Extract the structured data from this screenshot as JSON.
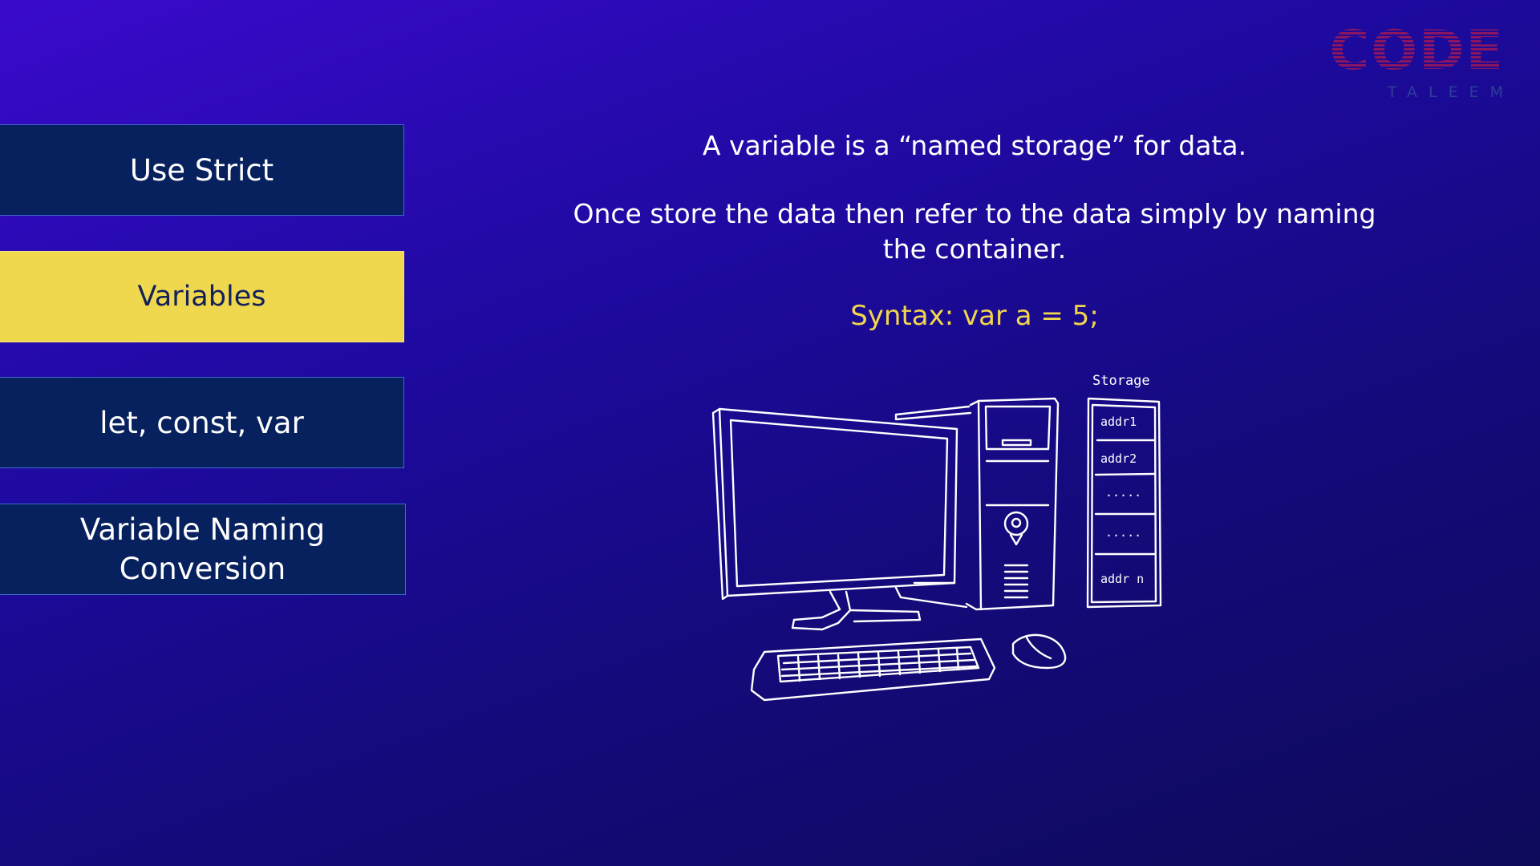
{
  "logo": {
    "main": "CODE",
    "sub": "TALEEM"
  },
  "nav": {
    "items": [
      {
        "label": "Use Strict",
        "active": false
      },
      {
        "label": "Variables",
        "active": true
      },
      {
        "label": "let, const, var",
        "active": false
      },
      {
        "label": "Variable Naming Conversion",
        "active": false
      }
    ]
  },
  "content": {
    "definition": "A variable is a “named storage” for data.",
    "explanation": "Once store the data then refer to the data simply by naming the container.",
    "syntax": "Syntax: var a = 5;"
  },
  "illustration": {
    "storage_title": "Storage",
    "slots": [
      "addr1",
      "addr2",
      ".....",
      ".....",
      "addr n"
    ]
  },
  "colors": {
    "accent_yellow": "#f0d84e",
    "nav_blue": "#07215e",
    "logo_red": "#8a1560"
  }
}
